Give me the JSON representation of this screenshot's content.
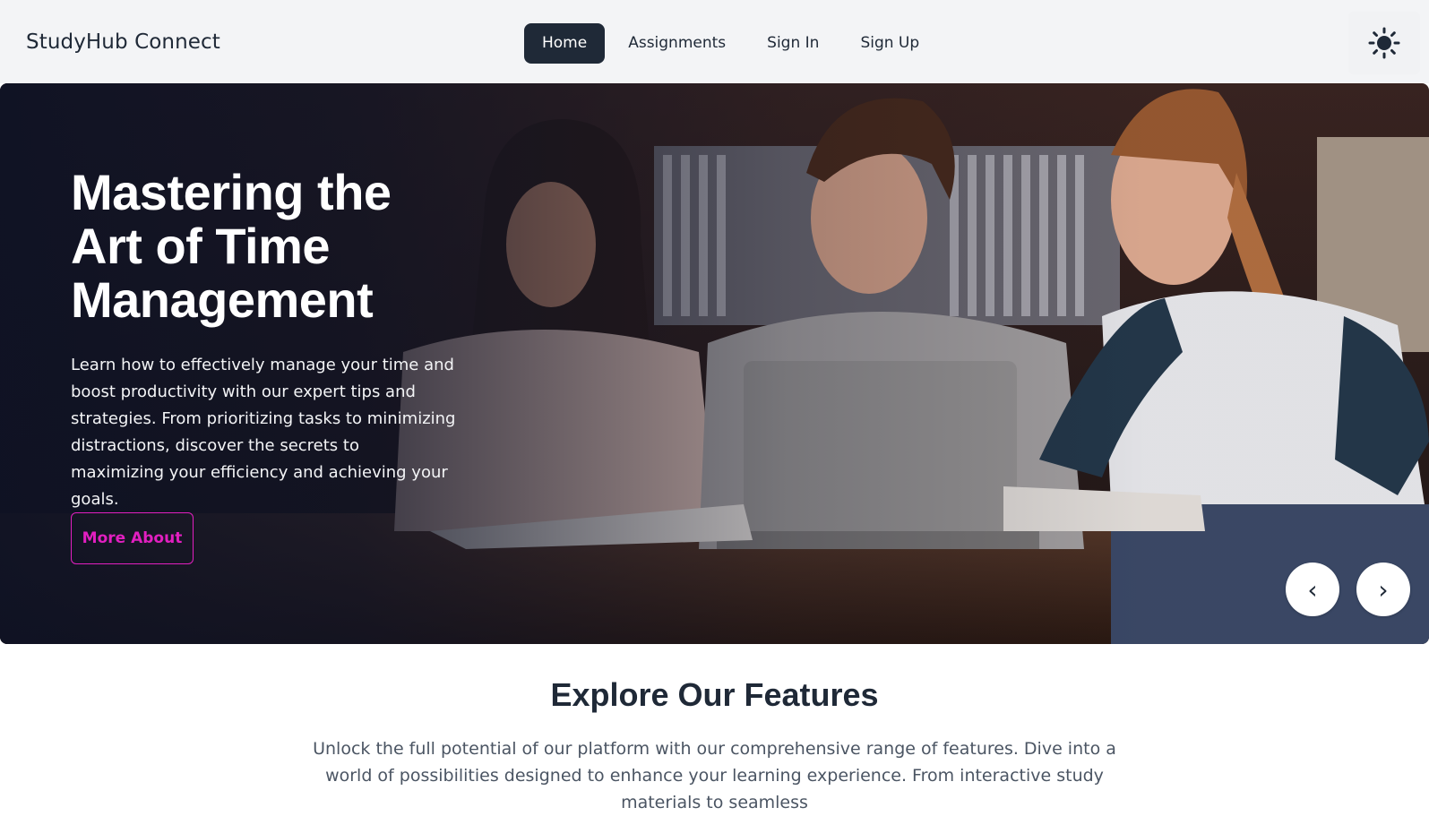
{
  "navbar": {
    "brand": "StudyHub Connect",
    "links": [
      {
        "label": "Home",
        "active": true
      },
      {
        "label": "Assignments",
        "active": false
      },
      {
        "label": "Sign In",
        "active": false
      },
      {
        "label": "Sign Up",
        "active": false
      }
    ],
    "theme_icon": "sun-icon"
  },
  "hero": {
    "title_line1": "Mastering the",
    "title_line2": "Art of Time",
    "title_line3": "Management",
    "description": "Learn how to effectively manage your time and boost productivity with our expert tips and strategies. From prioritizing tasks to minimizing distractions, discover the secrets to maximizing your efficiency and achieving your goals.",
    "button_label": "More About",
    "prev_label": "‹",
    "next_label": "›"
  },
  "features": {
    "title": "Explore Our Features",
    "description": "Unlock the full potential of our platform with our comprehensive range of features. Dive into a world of possibilities designed to enhance your learning experience. From interactive study materials to seamless"
  },
  "colors": {
    "accent": "#e21fc0",
    "nav_active_bg": "#1f2937",
    "navbar_bg": "#f3f4f6"
  }
}
